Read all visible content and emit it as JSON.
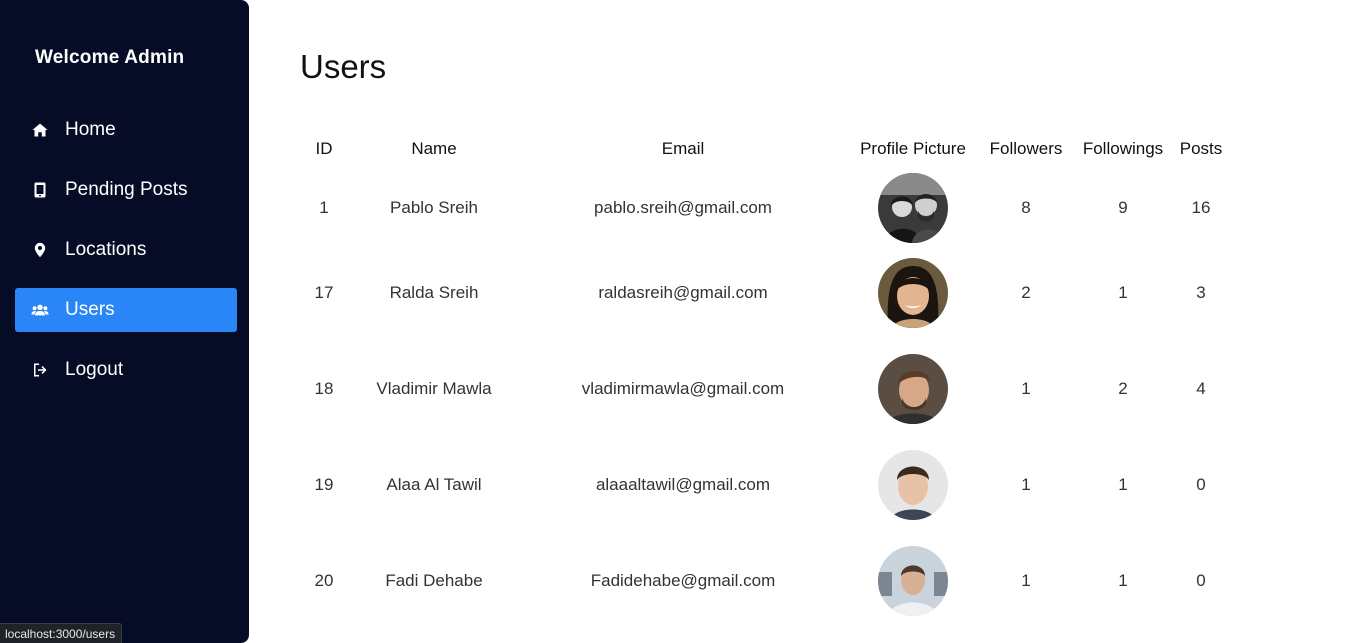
{
  "sidebar": {
    "brand": "Welcome Admin",
    "items": [
      {
        "label": "Home",
        "icon": "home-icon"
      },
      {
        "label": "Pending Posts",
        "icon": "mobile-icon"
      },
      {
        "label": "Locations",
        "icon": "location-pin-icon"
      },
      {
        "label": "Users",
        "icon": "users-icon",
        "active": true
      },
      {
        "label": "Logout",
        "icon": "logout-icon"
      }
    ]
  },
  "status_bar": {
    "url": "localhost:3000/users"
  },
  "main": {
    "title": "Users",
    "table": {
      "headers": [
        "ID",
        "Name",
        "Email",
        "Profile Picture",
        "Followers",
        "Followings",
        "Posts"
      ],
      "rows": [
        {
          "id": "1",
          "name": "Pablo Sreih",
          "email": "pablo.sreih@gmail.com",
          "followers": "8",
          "followings": "9",
          "posts": "16"
        },
        {
          "id": "17",
          "name": "Ralda Sreih",
          "email": "raldasreih@gmail.com",
          "followers": "2",
          "followings": "1",
          "posts": "3"
        },
        {
          "id": "18",
          "name": "Vladimir Mawla",
          "email": "vladimirmawla@gmail.com",
          "followers": "1",
          "followings": "2",
          "posts": "4"
        },
        {
          "id": "19",
          "name": "Alaa Al Tawil",
          "email": "alaaaltawil@gmail.com",
          "followers": "1",
          "followings": "1",
          "posts": "0"
        },
        {
          "id": "20",
          "name": "Fadi Dehabe",
          "email": "Fadidehabe@gmail.com",
          "followers": "1",
          "followings": "1",
          "posts": "0"
        }
      ]
    }
  },
  "colors": {
    "sidebar_bg": "#070c26",
    "active_item": "#2a86f7",
    "page_bg": "#ffffff"
  }
}
